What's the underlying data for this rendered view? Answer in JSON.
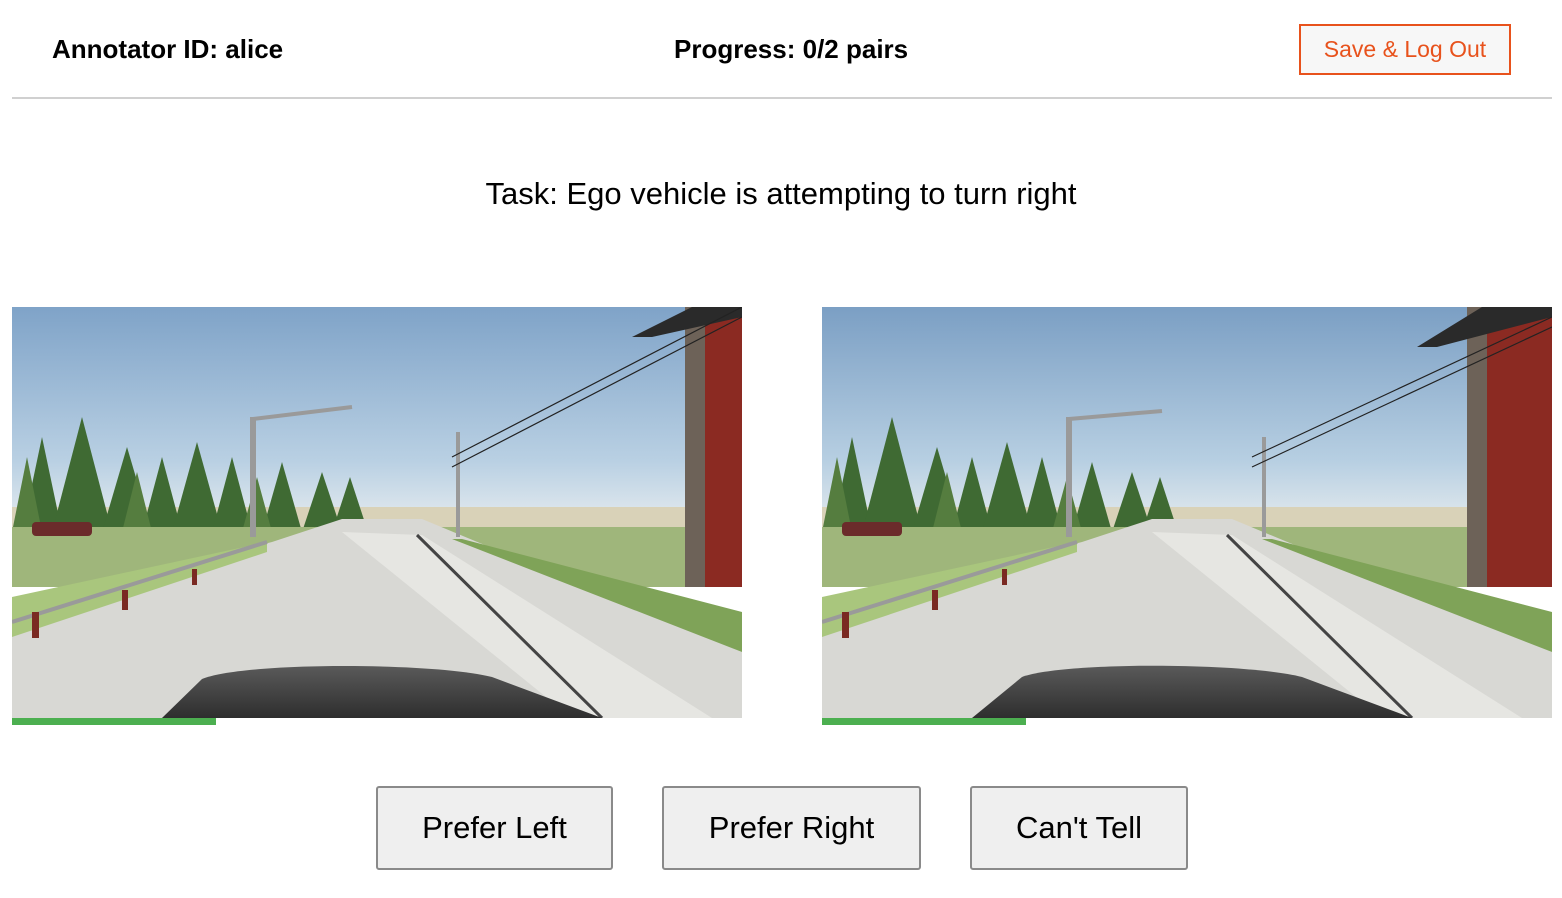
{
  "header": {
    "annotator_label": "Annotator ID: alice",
    "progress_label": "Progress: 0/2 pairs",
    "logout_label": "Save & Log Out"
  },
  "task": {
    "text": "Task: Ego vehicle is attempting to turn right"
  },
  "videos": {
    "left": {
      "playback_progress": 0.28
    },
    "right": {
      "playback_progress": 0.28
    }
  },
  "choices": {
    "prefer_left": "Prefer Left",
    "prefer_right": "Prefer Right",
    "cant_tell": "Can't Tell"
  },
  "colors": {
    "accent_orange": "#e8521c",
    "progress_green": "#4caf50"
  }
}
